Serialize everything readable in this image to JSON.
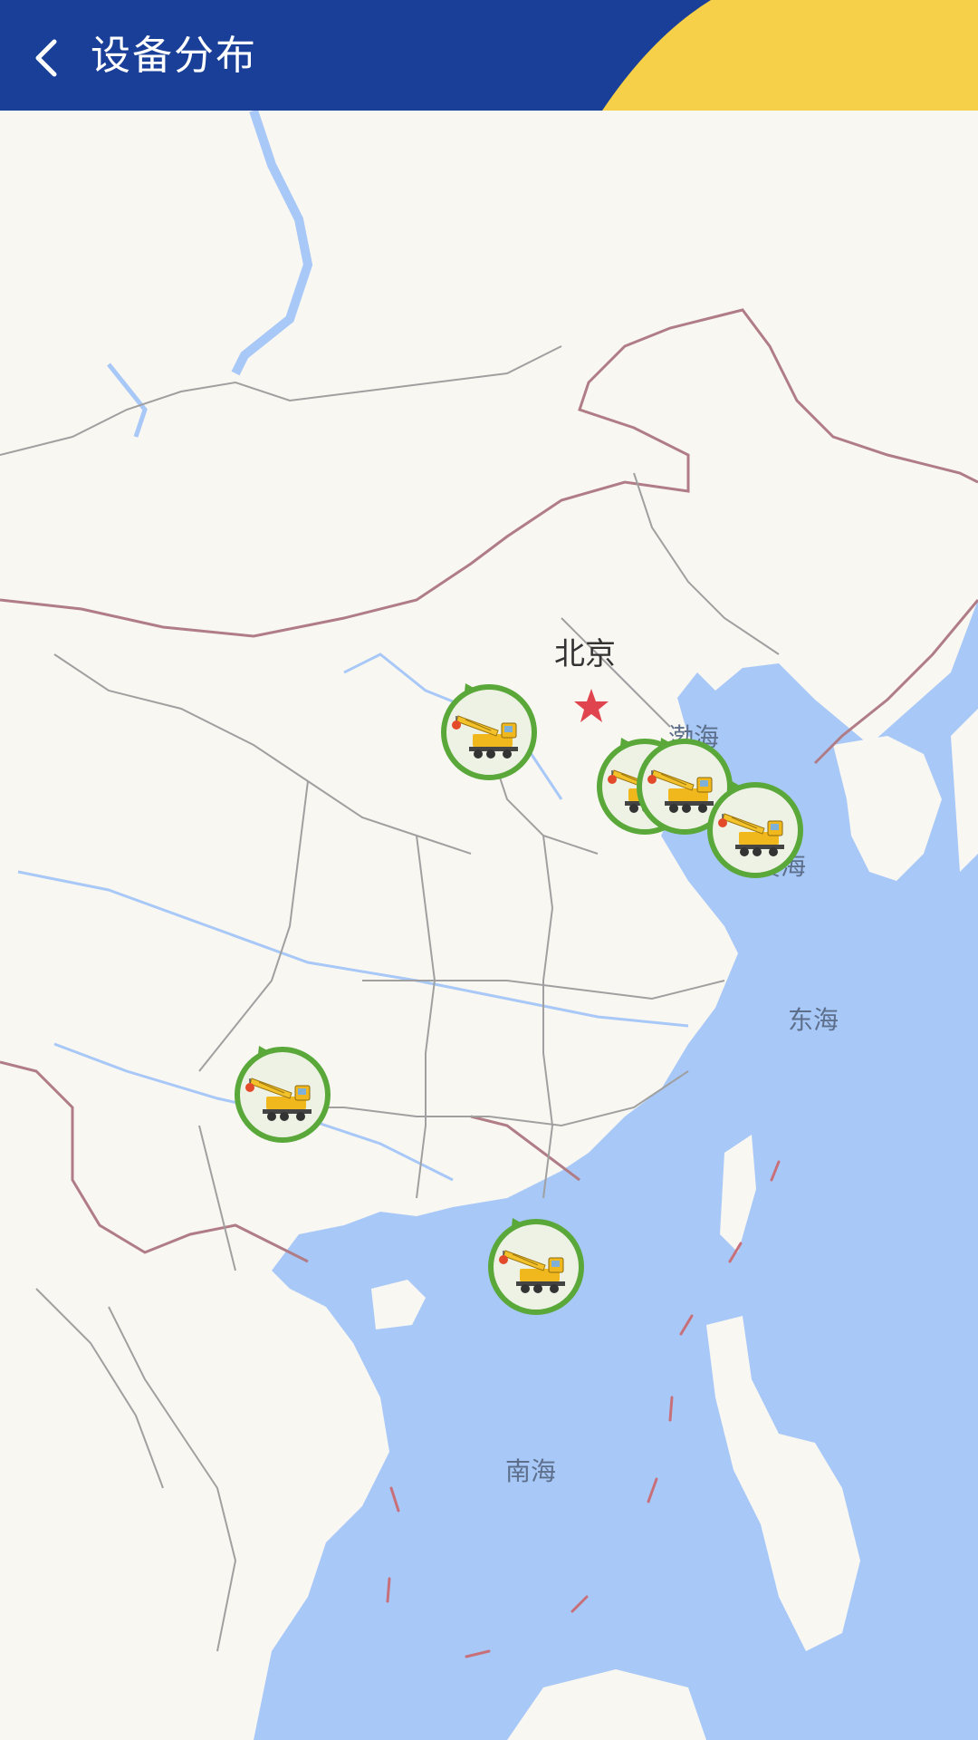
{
  "header": {
    "title": "设备分布",
    "background": "#1a3f98",
    "accent": "#f6d048",
    "back_icon": "chevron-left-icon"
  },
  "map": {
    "land_color": "#f9f7f2",
    "sea_color": "#a8c8f8",
    "capital": "北京",
    "capital_icon": "star-icon",
    "seas": [
      "渤海",
      "黄海",
      "东海",
      "南海"
    ]
  },
  "markers": {
    "icon": "crane-truck-icon",
    "ring_color": "#5aa83a",
    "count": 6
  }
}
